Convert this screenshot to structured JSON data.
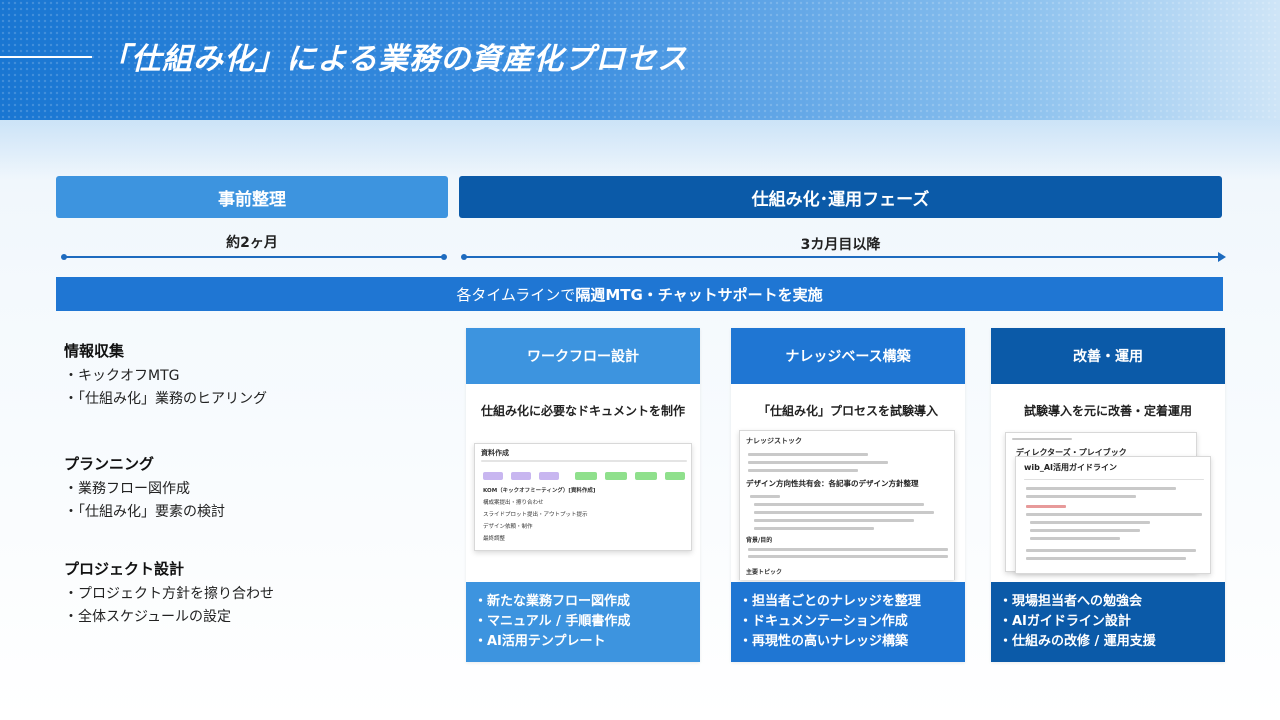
{
  "title": "「仕組み化」による業務の資産化プロセス",
  "phases": {
    "pre": {
      "label": "事前整理",
      "duration": "約2ヶ月"
    },
    "main": {
      "label": "仕組み化･運用フェーズ",
      "duration": "3カ月目以降"
    }
  },
  "banner": {
    "prefix": "各タイムラインで",
    "bold": "隔週MTG・チャットサポートを実施"
  },
  "left_sections": [
    {
      "title": "情報収集",
      "items": [
        "・キックオフMTG",
        "・「仕組み化」業務のヒアリング"
      ]
    },
    {
      "title": "プランニング",
      "items": [
        "・業務フロー図作成",
        "・「仕組み化」要素の検討"
      ]
    },
    {
      "title": "プロジェクト設計",
      "items": [
        "・プロジェクト方針を擦り合わせ",
        "・全体スケジュールの設定"
      ]
    }
  ],
  "cards": [
    {
      "title": "ワークフロー設計",
      "subtitle": "仕組み化に必要なドキュメントを制作",
      "items": [
        "・新たな業務フロー図作成",
        "・マニュアル / 手順書作成",
        "・AI活用テンプレート"
      ],
      "shot_texts": [
        "資料作成",
        "KOM（キックオフミーティング）[資料作成]",
        "構成案提出・擦り合わせ",
        "スライドプロット提出・アウトプット提示",
        "デザイン依頼・制作",
        "最終調整"
      ]
    },
    {
      "title": "ナレッジベース構築",
      "subtitle": "「仕組み化」プロセスを試験導入",
      "items": [
        "・担当者ごとのナレッジを整理",
        "・ドキュメンテーション作成",
        "・再現性の高いナレッジ構築"
      ],
      "shot_texts": [
        "ナレッジストック",
        "デザイン方向性共有会：各記事のデザイン方針整理",
        "背景/目的",
        "主要トピック"
      ]
    },
    {
      "title": "改善・運用",
      "subtitle": "試験導入を元に改善・定着運用",
      "items": [
        "・現場担当者への勉強会",
        "・AIガイドライン設計",
        "・仕組みの改修 / 運用支援"
      ],
      "shot_texts": [
        "ディレクターズ・プレイブック",
        "wib_AI活用ガイドライン"
      ]
    }
  ],
  "colors": {
    "light": "#3d94df",
    "mid": "#1f76d3",
    "dark": "#0b5aa8"
  }
}
